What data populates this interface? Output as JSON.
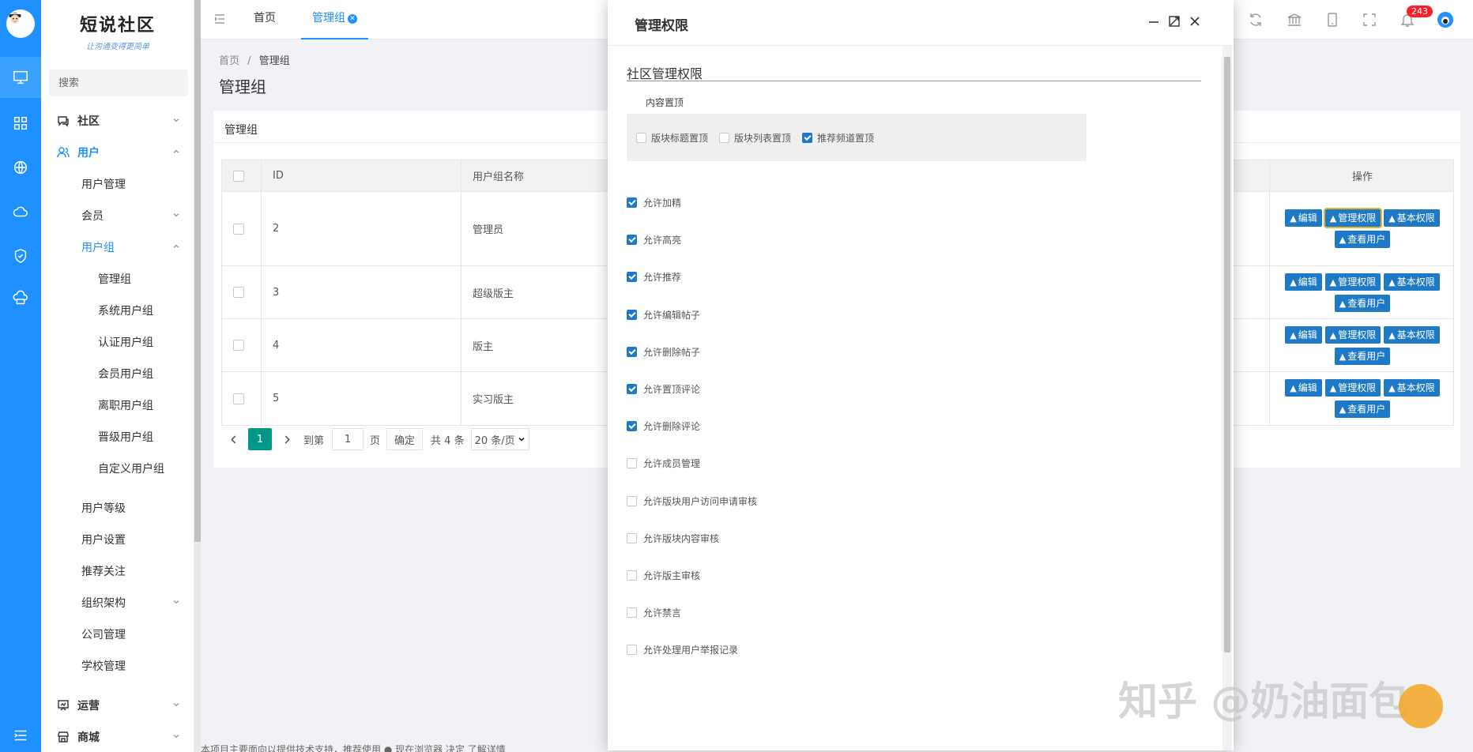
{
  "sidebar": {
    "logo_title": "短说社区",
    "logo_sub": "让沟通变得更简单",
    "search_placeholder": "搜索",
    "menu": {
      "community": "社区",
      "user": "用户",
      "user_manage": "用户管理",
      "member": "会员",
      "usergroup": "用户组",
      "groups": [
        "管理组",
        "系统用户组",
        "认证用户组",
        "会员用户组",
        "离职用户组",
        "晋级用户组",
        "自定义用户组"
      ],
      "user_level": "用户等级",
      "user_settings": "用户设置",
      "recommend_follow": "推荐关注",
      "org": "组织架构",
      "company": "公司管理",
      "school": "学校管理",
      "ops": "运营",
      "mall": "商城"
    }
  },
  "tabs": {
    "home": "首页",
    "group": "管理组"
  },
  "notifications": {
    "count": "243"
  },
  "breadcrumb": {
    "home": "首页",
    "sep": "/",
    "current": "管理组"
  },
  "page_title": "管理组",
  "card_title": "管理组",
  "table": {
    "headers": {
      "id": "ID",
      "name": "用户组名称",
      "ops": "操作"
    },
    "rows": [
      {
        "id": "2",
        "name": "管理员"
      },
      {
        "id": "3",
        "name": "超级版主"
      },
      {
        "id": "4",
        "name": "版主"
      },
      {
        "id": "5",
        "name": "实习版主"
      }
    ],
    "buttons": {
      "edit": "编辑",
      "manage": "管理权限",
      "basic": "基本权限",
      "view": "查看用户"
    }
  },
  "pager": {
    "current": "1",
    "goto": "到第",
    "page_input": "1",
    "page_unit": "页",
    "confirm": "确定",
    "total": "共 4 条",
    "per_page": "20 条/页"
  },
  "footer": "本项目主要面向以提供技术支持，推荐使用 ● 现在浏览器 决定 了解详情",
  "modal": {
    "title": "管理权限",
    "section": "社区管理权限",
    "pin_label": "内容置顶",
    "pin_options": [
      {
        "label": "版块标题置顶",
        "checked": false
      },
      {
        "label": "版块列表置顶",
        "checked": false
      },
      {
        "label": "推荐频道置顶",
        "checked": true
      }
    ],
    "perms": [
      {
        "label": "允许加精",
        "checked": true
      },
      {
        "label": "允许高亮",
        "checked": true
      },
      {
        "label": "允许推荐",
        "checked": true
      },
      {
        "label": "允许编辑帖子",
        "checked": true
      },
      {
        "label": "允许删除帖子",
        "checked": true
      },
      {
        "label": "允许置顶评论",
        "checked": true
      },
      {
        "label": "允许删除评论",
        "checked": true
      },
      {
        "label": "允许成员管理",
        "checked": false
      },
      {
        "label": "允许版块用户访问申请审核",
        "checked": false
      },
      {
        "label": "允许版块内容审核",
        "checked": false
      },
      {
        "label": "允许版主审核",
        "checked": false
      },
      {
        "label": "允许禁言",
        "checked": false
      },
      {
        "label": "允许处理用户举报记录",
        "checked": false
      }
    ]
  },
  "watermark": "知乎 @奶油面包",
  "colors": {
    "primary": "#1e90ff",
    "button": "#1e7ac6",
    "pager_active": "#009688",
    "badge": "#f5222d"
  }
}
